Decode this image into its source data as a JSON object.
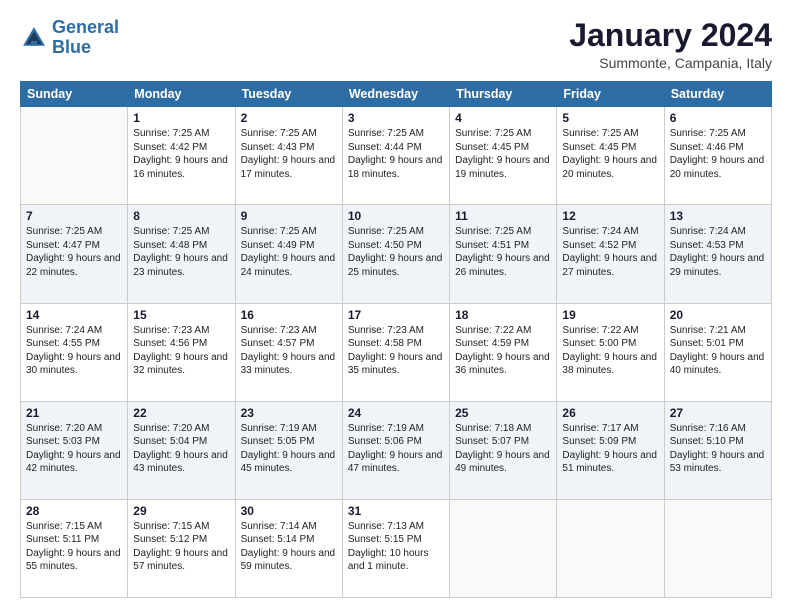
{
  "header": {
    "logo_line1": "General",
    "logo_line2": "Blue",
    "month_year": "January 2024",
    "location": "Summonte, Campania, Italy"
  },
  "weekdays": [
    "Sunday",
    "Monday",
    "Tuesday",
    "Wednesday",
    "Thursday",
    "Friday",
    "Saturday"
  ],
  "weeks": [
    [
      {
        "day": "",
        "sunrise": "",
        "sunset": "",
        "daylight": ""
      },
      {
        "day": "1",
        "sunrise": "Sunrise: 7:25 AM",
        "sunset": "Sunset: 4:42 PM",
        "daylight": "Daylight: 9 hours and 16 minutes."
      },
      {
        "day": "2",
        "sunrise": "Sunrise: 7:25 AM",
        "sunset": "Sunset: 4:43 PM",
        "daylight": "Daylight: 9 hours and 17 minutes."
      },
      {
        "day": "3",
        "sunrise": "Sunrise: 7:25 AM",
        "sunset": "Sunset: 4:44 PM",
        "daylight": "Daylight: 9 hours and 18 minutes."
      },
      {
        "day": "4",
        "sunrise": "Sunrise: 7:25 AM",
        "sunset": "Sunset: 4:45 PM",
        "daylight": "Daylight: 9 hours and 19 minutes."
      },
      {
        "day": "5",
        "sunrise": "Sunrise: 7:25 AM",
        "sunset": "Sunset: 4:45 PM",
        "daylight": "Daylight: 9 hours and 20 minutes."
      },
      {
        "day": "6",
        "sunrise": "Sunrise: 7:25 AM",
        "sunset": "Sunset: 4:46 PM",
        "daylight": "Daylight: 9 hours and 20 minutes."
      }
    ],
    [
      {
        "day": "7",
        "sunrise": "Sunrise: 7:25 AM",
        "sunset": "Sunset: 4:47 PM",
        "daylight": "Daylight: 9 hours and 22 minutes."
      },
      {
        "day": "8",
        "sunrise": "Sunrise: 7:25 AM",
        "sunset": "Sunset: 4:48 PM",
        "daylight": "Daylight: 9 hours and 23 minutes."
      },
      {
        "day": "9",
        "sunrise": "Sunrise: 7:25 AM",
        "sunset": "Sunset: 4:49 PM",
        "daylight": "Daylight: 9 hours and 24 minutes."
      },
      {
        "day": "10",
        "sunrise": "Sunrise: 7:25 AM",
        "sunset": "Sunset: 4:50 PM",
        "daylight": "Daylight: 9 hours and 25 minutes."
      },
      {
        "day": "11",
        "sunrise": "Sunrise: 7:25 AM",
        "sunset": "Sunset: 4:51 PM",
        "daylight": "Daylight: 9 hours and 26 minutes."
      },
      {
        "day": "12",
        "sunrise": "Sunrise: 7:24 AM",
        "sunset": "Sunset: 4:52 PM",
        "daylight": "Daylight: 9 hours and 27 minutes."
      },
      {
        "day": "13",
        "sunrise": "Sunrise: 7:24 AM",
        "sunset": "Sunset: 4:53 PM",
        "daylight": "Daylight: 9 hours and 29 minutes."
      }
    ],
    [
      {
        "day": "14",
        "sunrise": "Sunrise: 7:24 AM",
        "sunset": "Sunset: 4:55 PM",
        "daylight": "Daylight: 9 hours and 30 minutes."
      },
      {
        "day": "15",
        "sunrise": "Sunrise: 7:23 AM",
        "sunset": "Sunset: 4:56 PM",
        "daylight": "Daylight: 9 hours and 32 minutes."
      },
      {
        "day": "16",
        "sunrise": "Sunrise: 7:23 AM",
        "sunset": "Sunset: 4:57 PM",
        "daylight": "Daylight: 9 hours and 33 minutes."
      },
      {
        "day": "17",
        "sunrise": "Sunrise: 7:23 AM",
        "sunset": "Sunset: 4:58 PM",
        "daylight": "Daylight: 9 hours and 35 minutes."
      },
      {
        "day": "18",
        "sunrise": "Sunrise: 7:22 AM",
        "sunset": "Sunset: 4:59 PM",
        "daylight": "Daylight: 9 hours and 36 minutes."
      },
      {
        "day": "19",
        "sunrise": "Sunrise: 7:22 AM",
        "sunset": "Sunset: 5:00 PM",
        "daylight": "Daylight: 9 hours and 38 minutes."
      },
      {
        "day": "20",
        "sunrise": "Sunrise: 7:21 AM",
        "sunset": "Sunset: 5:01 PM",
        "daylight": "Daylight: 9 hours and 40 minutes."
      }
    ],
    [
      {
        "day": "21",
        "sunrise": "Sunrise: 7:20 AM",
        "sunset": "Sunset: 5:03 PM",
        "daylight": "Daylight: 9 hours and 42 minutes."
      },
      {
        "day": "22",
        "sunrise": "Sunrise: 7:20 AM",
        "sunset": "Sunset: 5:04 PM",
        "daylight": "Daylight: 9 hours and 43 minutes."
      },
      {
        "day": "23",
        "sunrise": "Sunrise: 7:19 AM",
        "sunset": "Sunset: 5:05 PM",
        "daylight": "Daylight: 9 hours and 45 minutes."
      },
      {
        "day": "24",
        "sunrise": "Sunrise: 7:19 AM",
        "sunset": "Sunset: 5:06 PM",
        "daylight": "Daylight: 9 hours and 47 minutes."
      },
      {
        "day": "25",
        "sunrise": "Sunrise: 7:18 AM",
        "sunset": "Sunset: 5:07 PM",
        "daylight": "Daylight: 9 hours and 49 minutes."
      },
      {
        "day": "26",
        "sunrise": "Sunrise: 7:17 AM",
        "sunset": "Sunset: 5:09 PM",
        "daylight": "Daylight: 9 hours and 51 minutes."
      },
      {
        "day": "27",
        "sunrise": "Sunrise: 7:16 AM",
        "sunset": "Sunset: 5:10 PM",
        "daylight": "Daylight: 9 hours and 53 minutes."
      }
    ],
    [
      {
        "day": "28",
        "sunrise": "Sunrise: 7:15 AM",
        "sunset": "Sunset: 5:11 PM",
        "daylight": "Daylight: 9 hours and 55 minutes."
      },
      {
        "day": "29",
        "sunrise": "Sunrise: 7:15 AM",
        "sunset": "Sunset: 5:12 PM",
        "daylight": "Daylight: 9 hours and 57 minutes."
      },
      {
        "day": "30",
        "sunrise": "Sunrise: 7:14 AM",
        "sunset": "Sunset: 5:14 PM",
        "daylight": "Daylight: 9 hours and 59 minutes."
      },
      {
        "day": "31",
        "sunrise": "Sunrise: 7:13 AM",
        "sunset": "Sunset: 5:15 PM",
        "daylight": "Daylight: 10 hours and 1 minute."
      },
      {
        "day": "",
        "sunrise": "",
        "sunset": "",
        "daylight": ""
      },
      {
        "day": "",
        "sunrise": "",
        "sunset": "",
        "daylight": ""
      },
      {
        "day": "",
        "sunrise": "",
        "sunset": "",
        "daylight": ""
      }
    ]
  ]
}
